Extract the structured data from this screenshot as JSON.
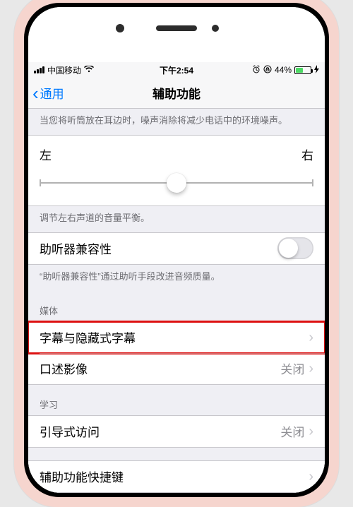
{
  "status": {
    "carrier": "中国移动",
    "time": "下午2:54",
    "battery_pct": "44%"
  },
  "nav": {
    "back_label": "通用",
    "title": "辅助功能"
  },
  "noise": {
    "note": "当您将听筒放在耳边时，噪声消除将减少电话中的环境噪声。"
  },
  "balance": {
    "left": "左",
    "right": "右",
    "footer": "调节左右声道的音量平衡。"
  },
  "hearing_aid": {
    "label": "助听器兼容性",
    "on": false,
    "footer": "“助听器兼容性”通过助听手段改进音频质量。"
  },
  "media": {
    "header": "媒体",
    "subtitles": {
      "label": "字幕与隐藏式字幕"
    },
    "audio_desc": {
      "label": "口述影像",
      "value": "关闭"
    }
  },
  "learning": {
    "header": "学习",
    "guided": {
      "label": "引导式访问",
      "value": "关闭"
    }
  },
  "shortcut": {
    "label": "辅助功能快捷键"
  }
}
